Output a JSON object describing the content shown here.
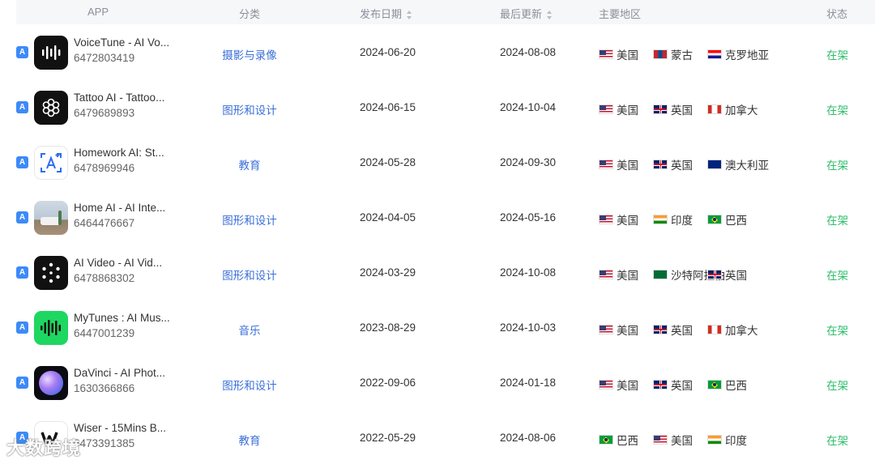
{
  "header": {
    "app": "APP",
    "category": "分类",
    "release_date": "发布日期",
    "last_update": "最后更新",
    "main_regions": "主要地区",
    "status": "状态"
  },
  "rows": [
    {
      "name": "VoiceTune - AI Vo...",
      "id": "6472803419",
      "category": "摄影与录像",
      "release": "2024-06-20",
      "update": "2024-08-08",
      "regions": [
        {
          "flag": "us",
          "label": "美国"
        },
        {
          "flag": "mn",
          "label": "蒙古"
        },
        {
          "flag": "hr",
          "label": "克罗地亚"
        }
      ],
      "status": "在架",
      "icon": "waveform-icon"
    },
    {
      "name": "Tattoo AI - Tattoo...",
      "id": "6479689893",
      "category": "图形和设计",
      "release": "2024-06-15",
      "update": "2024-10-04",
      "regions": [
        {
          "flag": "us",
          "label": "美国"
        },
        {
          "flag": "gb",
          "label": "英国"
        },
        {
          "flag": "ca",
          "label": "加拿大"
        }
      ],
      "status": "在架",
      "icon": "flower-pattern-icon"
    },
    {
      "name": "Homework AI: St...",
      "id": "6478969946",
      "category": "教育",
      "release": "2024-05-28",
      "update": "2024-09-30",
      "regions": [
        {
          "flag": "us",
          "label": "美国"
        },
        {
          "flag": "gb",
          "label": "英国"
        },
        {
          "flag": "au",
          "label": "澳大利亚"
        }
      ],
      "status": "在架",
      "icon": "ai-scan-icon"
    },
    {
      "name": "Home AI - AI Inte...",
      "id": "6464476667",
      "category": "图形和设计",
      "release": "2024-04-05",
      "update": "2024-05-16",
      "regions": [
        {
          "flag": "us",
          "label": "美国"
        },
        {
          "flag": "in",
          "label": "印度"
        },
        {
          "flag": "br",
          "label": "巴西"
        }
      ],
      "status": "在架",
      "icon": "interior-photo-icon"
    },
    {
      "name": "AI Video - AI Vid...",
      "id": "6478868302",
      "category": "图形和设计",
      "release": "2024-03-29",
      "update": "2024-10-08",
      "regions": [
        {
          "flag": "us",
          "label": "美国"
        },
        {
          "flag": "sa",
          "label": "沙特阿拉伯"
        },
        {
          "flag": "gb",
          "label": "英国"
        }
      ],
      "status": "在架",
      "icon": "dot-ring-icon"
    },
    {
      "name": "MyTunes : AI Mus...",
      "id": "6447001239",
      "category": "音乐",
      "release": "2023-08-29",
      "update": "2024-10-03",
      "regions": [
        {
          "flag": "us",
          "label": "美国"
        },
        {
          "flag": "gb",
          "label": "英国"
        },
        {
          "flag": "ca",
          "label": "加拿大"
        }
      ],
      "status": "在架",
      "icon": "music-wave-icon"
    },
    {
      "name": "DaVinci - AI Phot...",
      "id": "1630366866",
      "category": "图形和设计",
      "release": "2022-09-06",
      "update": "2024-01-18",
      "regions": [
        {
          "flag": "us",
          "label": "美国"
        },
        {
          "flag": "gb",
          "label": "英国"
        },
        {
          "flag": "br",
          "label": "巴西"
        }
      ],
      "status": "在架",
      "icon": "gradient-orb-icon"
    },
    {
      "name": "Wiser - 15Mins B...",
      "id": "6473391385",
      "category": "教育",
      "release": "2022-05-29",
      "update": "2024-08-06",
      "regions": [
        {
          "flag": "br",
          "label": "巴西"
        },
        {
          "flag": "us",
          "label": "美国"
        },
        {
          "flag": "in",
          "label": "印度"
        }
      ],
      "status": "在架",
      "icon": "wiser-logo-icon"
    }
  ],
  "watermark": "大数跨境",
  "colors": {
    "category_link": "#3a6fd8",
    "status_green": "#2ebd6b",
    "header_bg": "#f6f7f9",
    "store_blue": "#3d8af7"
  }
}
